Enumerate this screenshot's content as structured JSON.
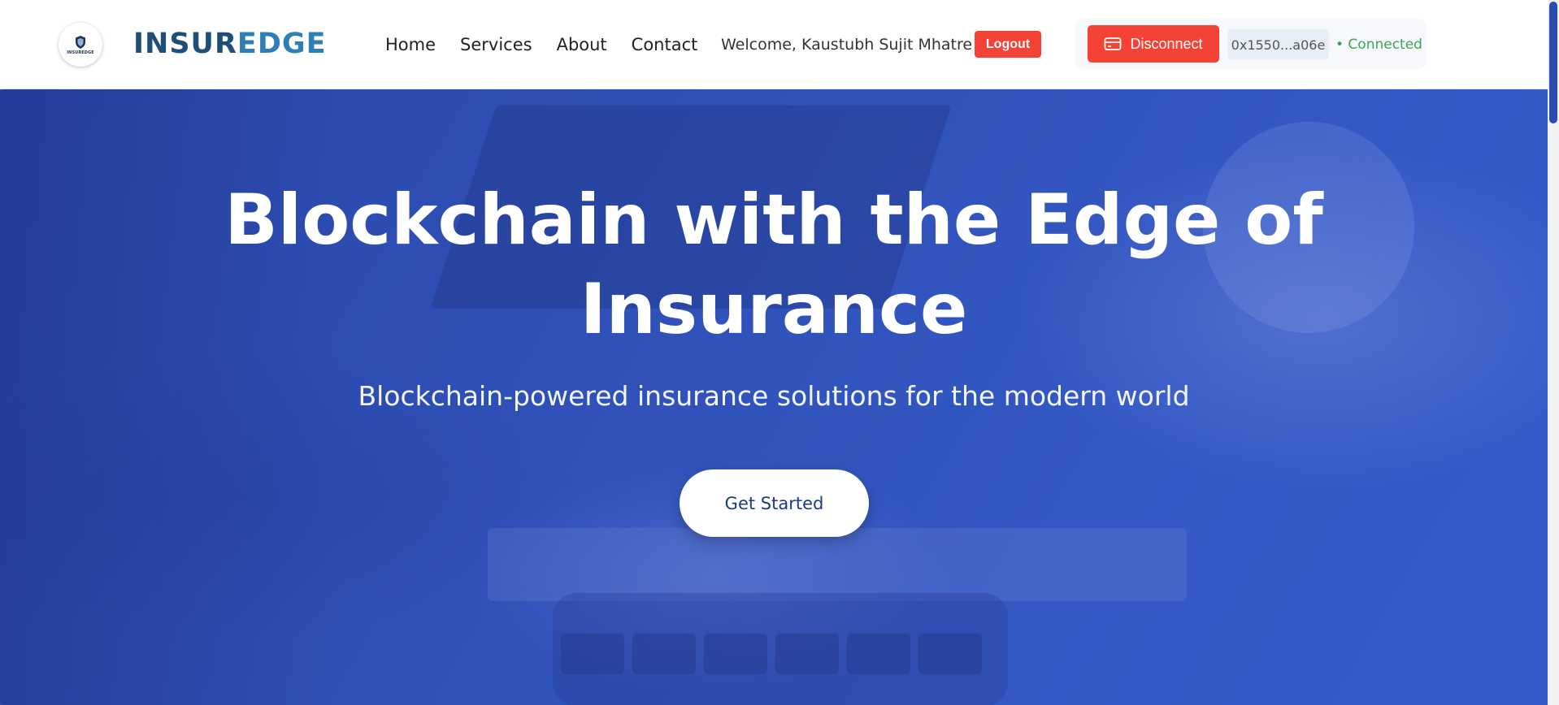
{
  "brand": {
    "logo_small_text": "INSUREDGE",
    "name_part1": "INSUR",
    "name_part2": "EDGE",
    "primary_color": "#1f4e79",
    "secondary_color": "#2e7fb8"
  },
  "nav": {
    "items": [
      {
        "label": "Home"
      },
      {
        "label": "Services"
      },
      {
        "label": "About"
      },
      {
        "label": "Contact"
      }
    ]
  },
  "user": {
    "welcome_text": "Welcome, Kaustubh Sujit Mhatre",
    "logout_label": "Logout"
  },
  "wallet": {
    "disconnect_label": "Disconnect",
    "address": "0x1550...a06e",
    "status": "• Connected",
    "status_color": "#3aa655",
    "button_color": "#f44336",
    "icon": "wallet-icon"
  },
  "hero": {
    "title_line1": "Blockchain with the Edge of",
    "title_line2": "Insurance",
    "subtitle": "Blockchain-powered insurance solutions for the modern world",
    "cta_label": "Get Started",
    "background_color": "#2f51b8"
  }
}
